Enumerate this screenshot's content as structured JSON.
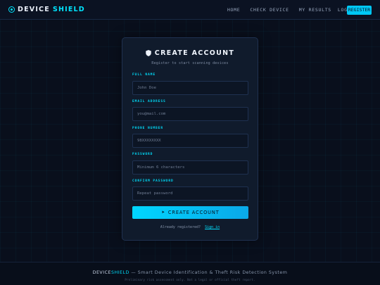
{
  "brand": {
    "part1": "DEVICE",
    "part2": "SHIELD",
    "icon": "target-icon"
  },
  "nav": {
    "links": [
      "HOME",
      "CHECK DEVICE",
      "MY RESULTS"
    ],
    "login": "LOGIN",
    "register": "REGISTER"
  },
  "form": {
    "icon": "shield-icon",
    "title": "CREATE ACCOUNT",
    "subtitle": "Register to start scanning devices",
    "fields": [
      {
        "label": "FULL NAME",
        "placeholder": "John Doe"
      },
      {
        "label": "EMAIL ADDRESS",
        "placeholder": "you@mail.com"
      },
      {
        "label": "PHONE NUMBER",
        "placeholder": "98XXXXXXXX"
      },
      {
        "label": "PASSWORD",
        "placeholder": "Minimum 6 characters"
      },
      {
        "label": "CONFIRM PASSWORD",
        "placeholder": "Repeat password"
      }
    ],
    "submit_arrow": "➤",
    "submit_label": "CREATE ACCOUNT",
    "login_prompt": "Already registered?",
    "login_link": "Sign in"
  },
  "footer": {
    "brand_part1": "DEVICE",
    "brand_part2": "SHIELD",
    "tagline": " — Smart Device Identification & Theft Risk Detection System",
    "disclaimer": "Preliminary risk assessment only. Not a legal or official theft report."
  },
  "colors": {
    "accent": "#00e5ff",
    "background": "#090f1c",
    "card": "#101b2c"
  }
}
